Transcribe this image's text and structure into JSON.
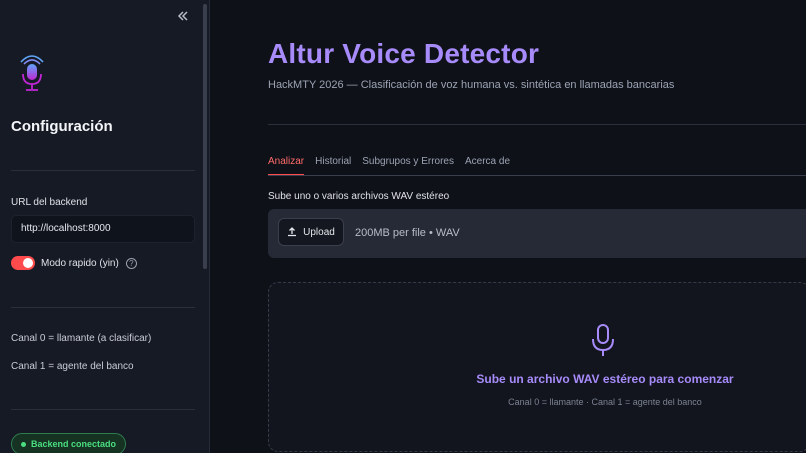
{
  "sidebar": {
    "collapse_icon": "double-chevron-left-icon",
    "title": "Configuración",
    "backend_label": "URL del backend",
    "backend_value": "http://localhost:8000",
    "toggle_label": "Modo rapido (yin)",
    "toggle_on": true,
    "help_glyph": "?",
    "channel0": "Canal 0 = llamante (a clasificar)",
    "channel1": "Canal 1 = agente del banco",
    "status_badge": "Backend conectado"
  },
  "main": {
    "title": "Altur Voice Detector",
    "subtitle": "HackMTY 2026 — Clasificación de voz humana vs. sintética en llamadas bancarias",
    "tabs": [
      {
        "label": "Analizar",
        "active": true
      },
      {
        "label": "Historial",
        "active": false
      },
      {
        "label": "Subgrupos y Errores",
        "active": false
      },
      {
        "label": "Acerca de",
        "active": false
      }
    ],
    "upload": {
      "label": "Sube uno o varios archivos WAV estéreo",
      "button": "Upload",
      "limit": "200MB per file • WAV"
    },
    "empty_state": {
      "title": "Sube un archivo WAV estéreo para comenzar",
      "subtitle": "Canal 0 = llamante · Canal 1 = agente del banco"
    }
  },
  "colors": {
    "accent": "#a78bfa",
    "danger": "#ff4b4b",
    "success": "#4ade80",
    "background": "#0e1117",
    "sidebar": "#161a24"
  }
}
